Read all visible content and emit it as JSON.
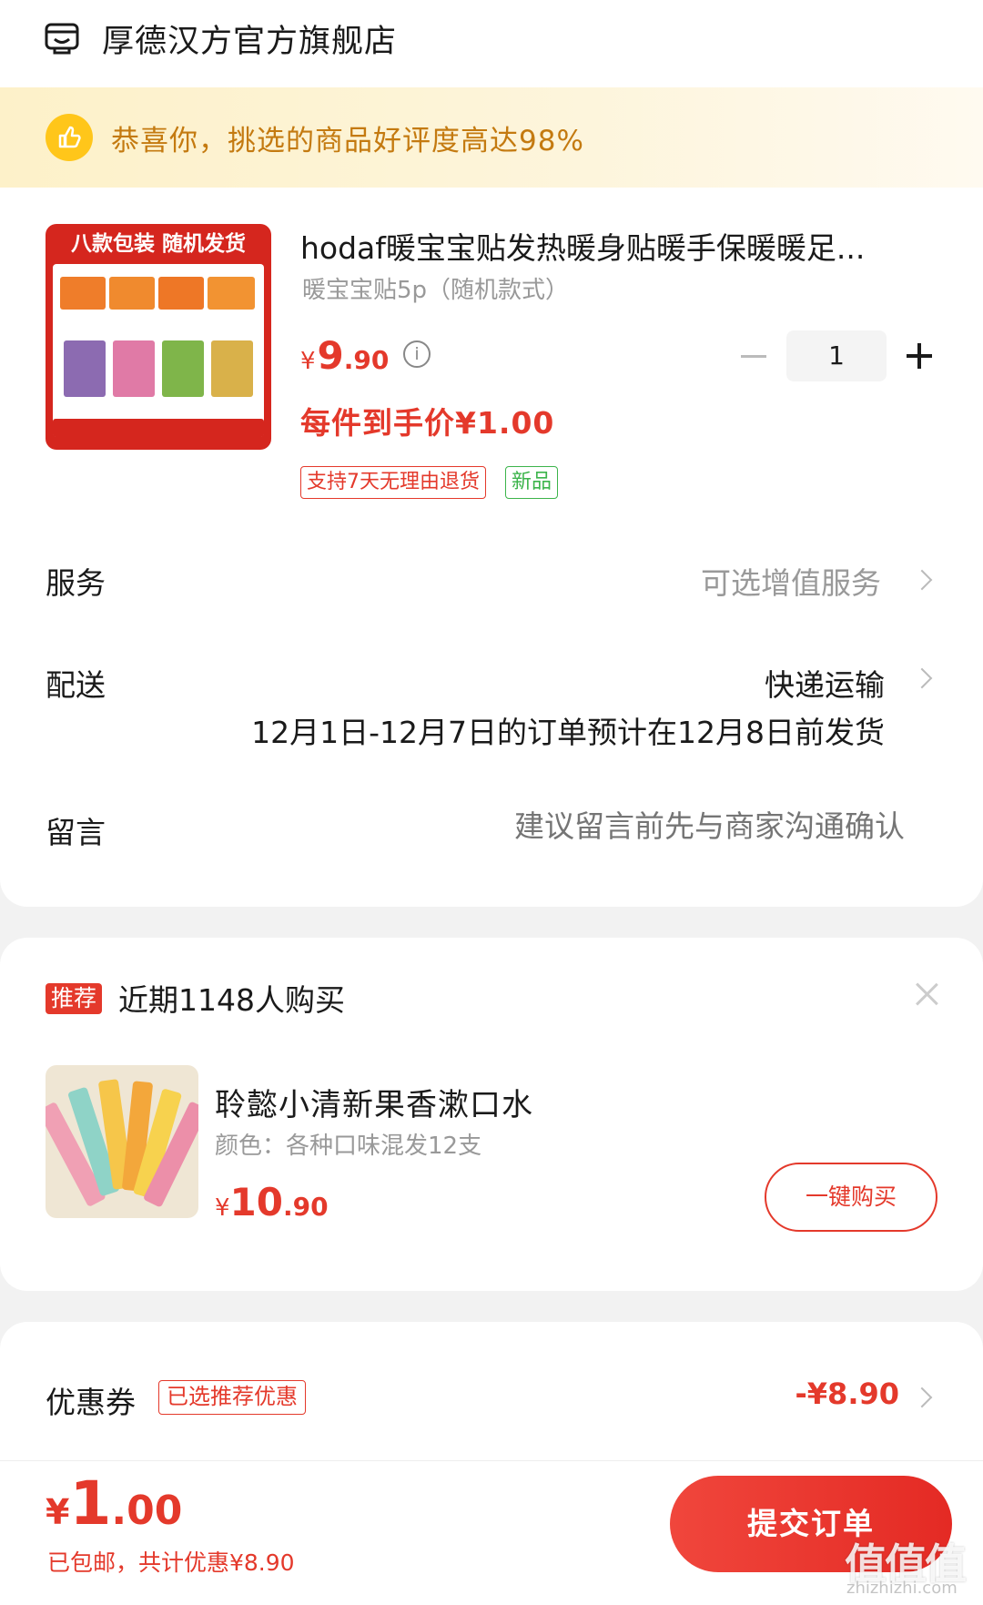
{
  "store": {
    "name": "厚德汉方官方旗舰店",
    "icon": "store-icon"
  },
  "banner": {
    "text": "恭喜你，挑选的商品好评度高达98%",
    "icon": "thumbs-up-icon"
  },
  "product": {
    "image_header": "八款包装 随机发货",
    "title": "hodaf暖宝宝贴发热暖身贴暖手保暖暖足...",
    "spec": "暖宝宝贴5p（随机款式）",
    "price_yen": "¥",
    "price_int": "9",
    "price_dec": ".90",
    "quantity": "1",
    "unit_price": "每件到手价¥1.00",
    "tags": [
      "支持7天无理由退货",
      "新品"
    ]
  },
  "rows": {
    "service": {
      "label": "服务",
      "value": "可选增值服务"
    },
    "delivery": {
      "label": "配送",
      "value": "快递运输",
      "note": "12月1日-12月7日的订单预计在12月8日前发货"
    },
    "message": {
      "label": "留言",
      "placeholder": "建议留言前先与商家沟通确认"
    }
  },
  "recommend": {
    "badge": "推荐",
    "title": "近期1148人购买",
    "item": {
      "name": "聆懿小清新果香漱口水",
      "spec": "颜色：各种口味混发12支",
      "price_yen": "¥",
      "price_int": "10",
      "price_dec": ".90",
      "buy_label": "一键购买"
    }
  },
  "coupon": {
    "label": "优惠券",
    "tag": "已选推荐优惠",
    "value": "-¥8.90"
  },
  "footer": {
    "total_yen": "¥",
    "total_int": "1",
    "total_dec": ".00",
    "note": "已包邮，共计优惠¥8.90",
    "submit_label": "提交订单"
  },
  "watermark": {
    "main": "值值值",
    "sub": "zhizhizhi.com"
  },
  "colors": {
    "accent": "#e4392b",
    "banner_text": "#c47a10",
    "new_tag": "#3cb44b"
  }
}
